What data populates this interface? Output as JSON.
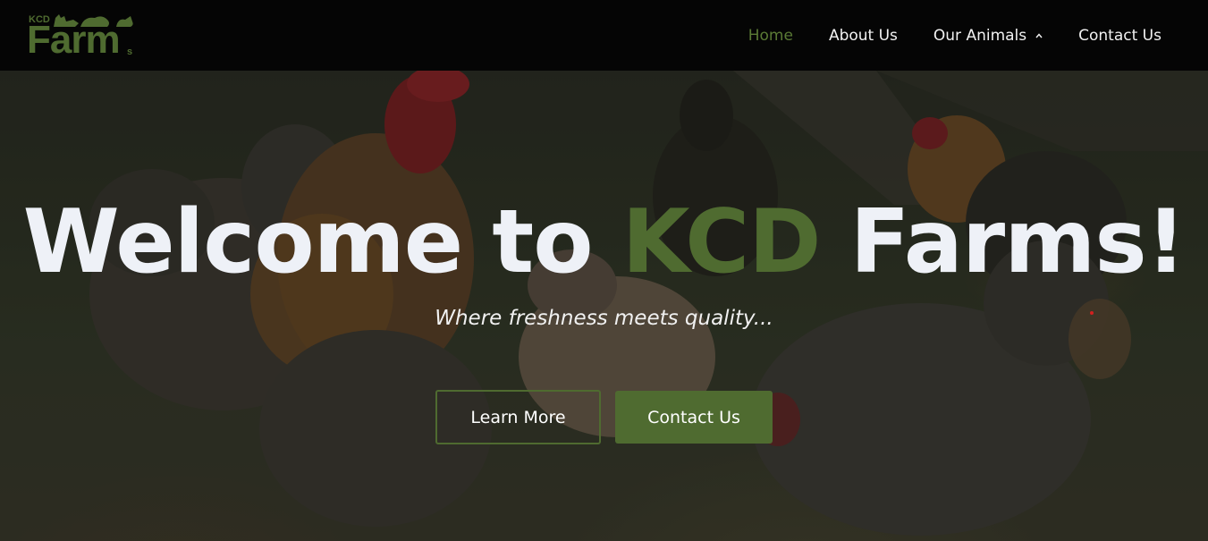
{
  "header": {
    "logo": {
      "small_text": "KCD",
      "main_text": "Farm",
      "suffix_text": "s"
    },
    "nav": [
      {
        "label": "Home",
        "active": true
      },
      {
        "label": "About Us",
        "active": false
      },
      {
        "label": "Our Animals",
        "active": false,
        "has_dropdown": true
      },
      {
        "label": "Contact Us",
        "active": false
      }
    ]
  },
  "hero": {
    "title_prefix": "Welcome to ",
    "title_brand": "KCD",
    "title_suffix": " Farms!",
    "subtitle": "Where freshness meets quality...",
    "primary_button": "Learn More",
    "secondary_button": "Contact Us",
    "background_image": "chickens-in-farmyard"
  },
  "colors": {
    "brand_green": "#4f6b30",
    "nav_active": "#5a7a35",
    "header_bg": "#050505",
    "title_text": "#eef1f7"
  }
}
